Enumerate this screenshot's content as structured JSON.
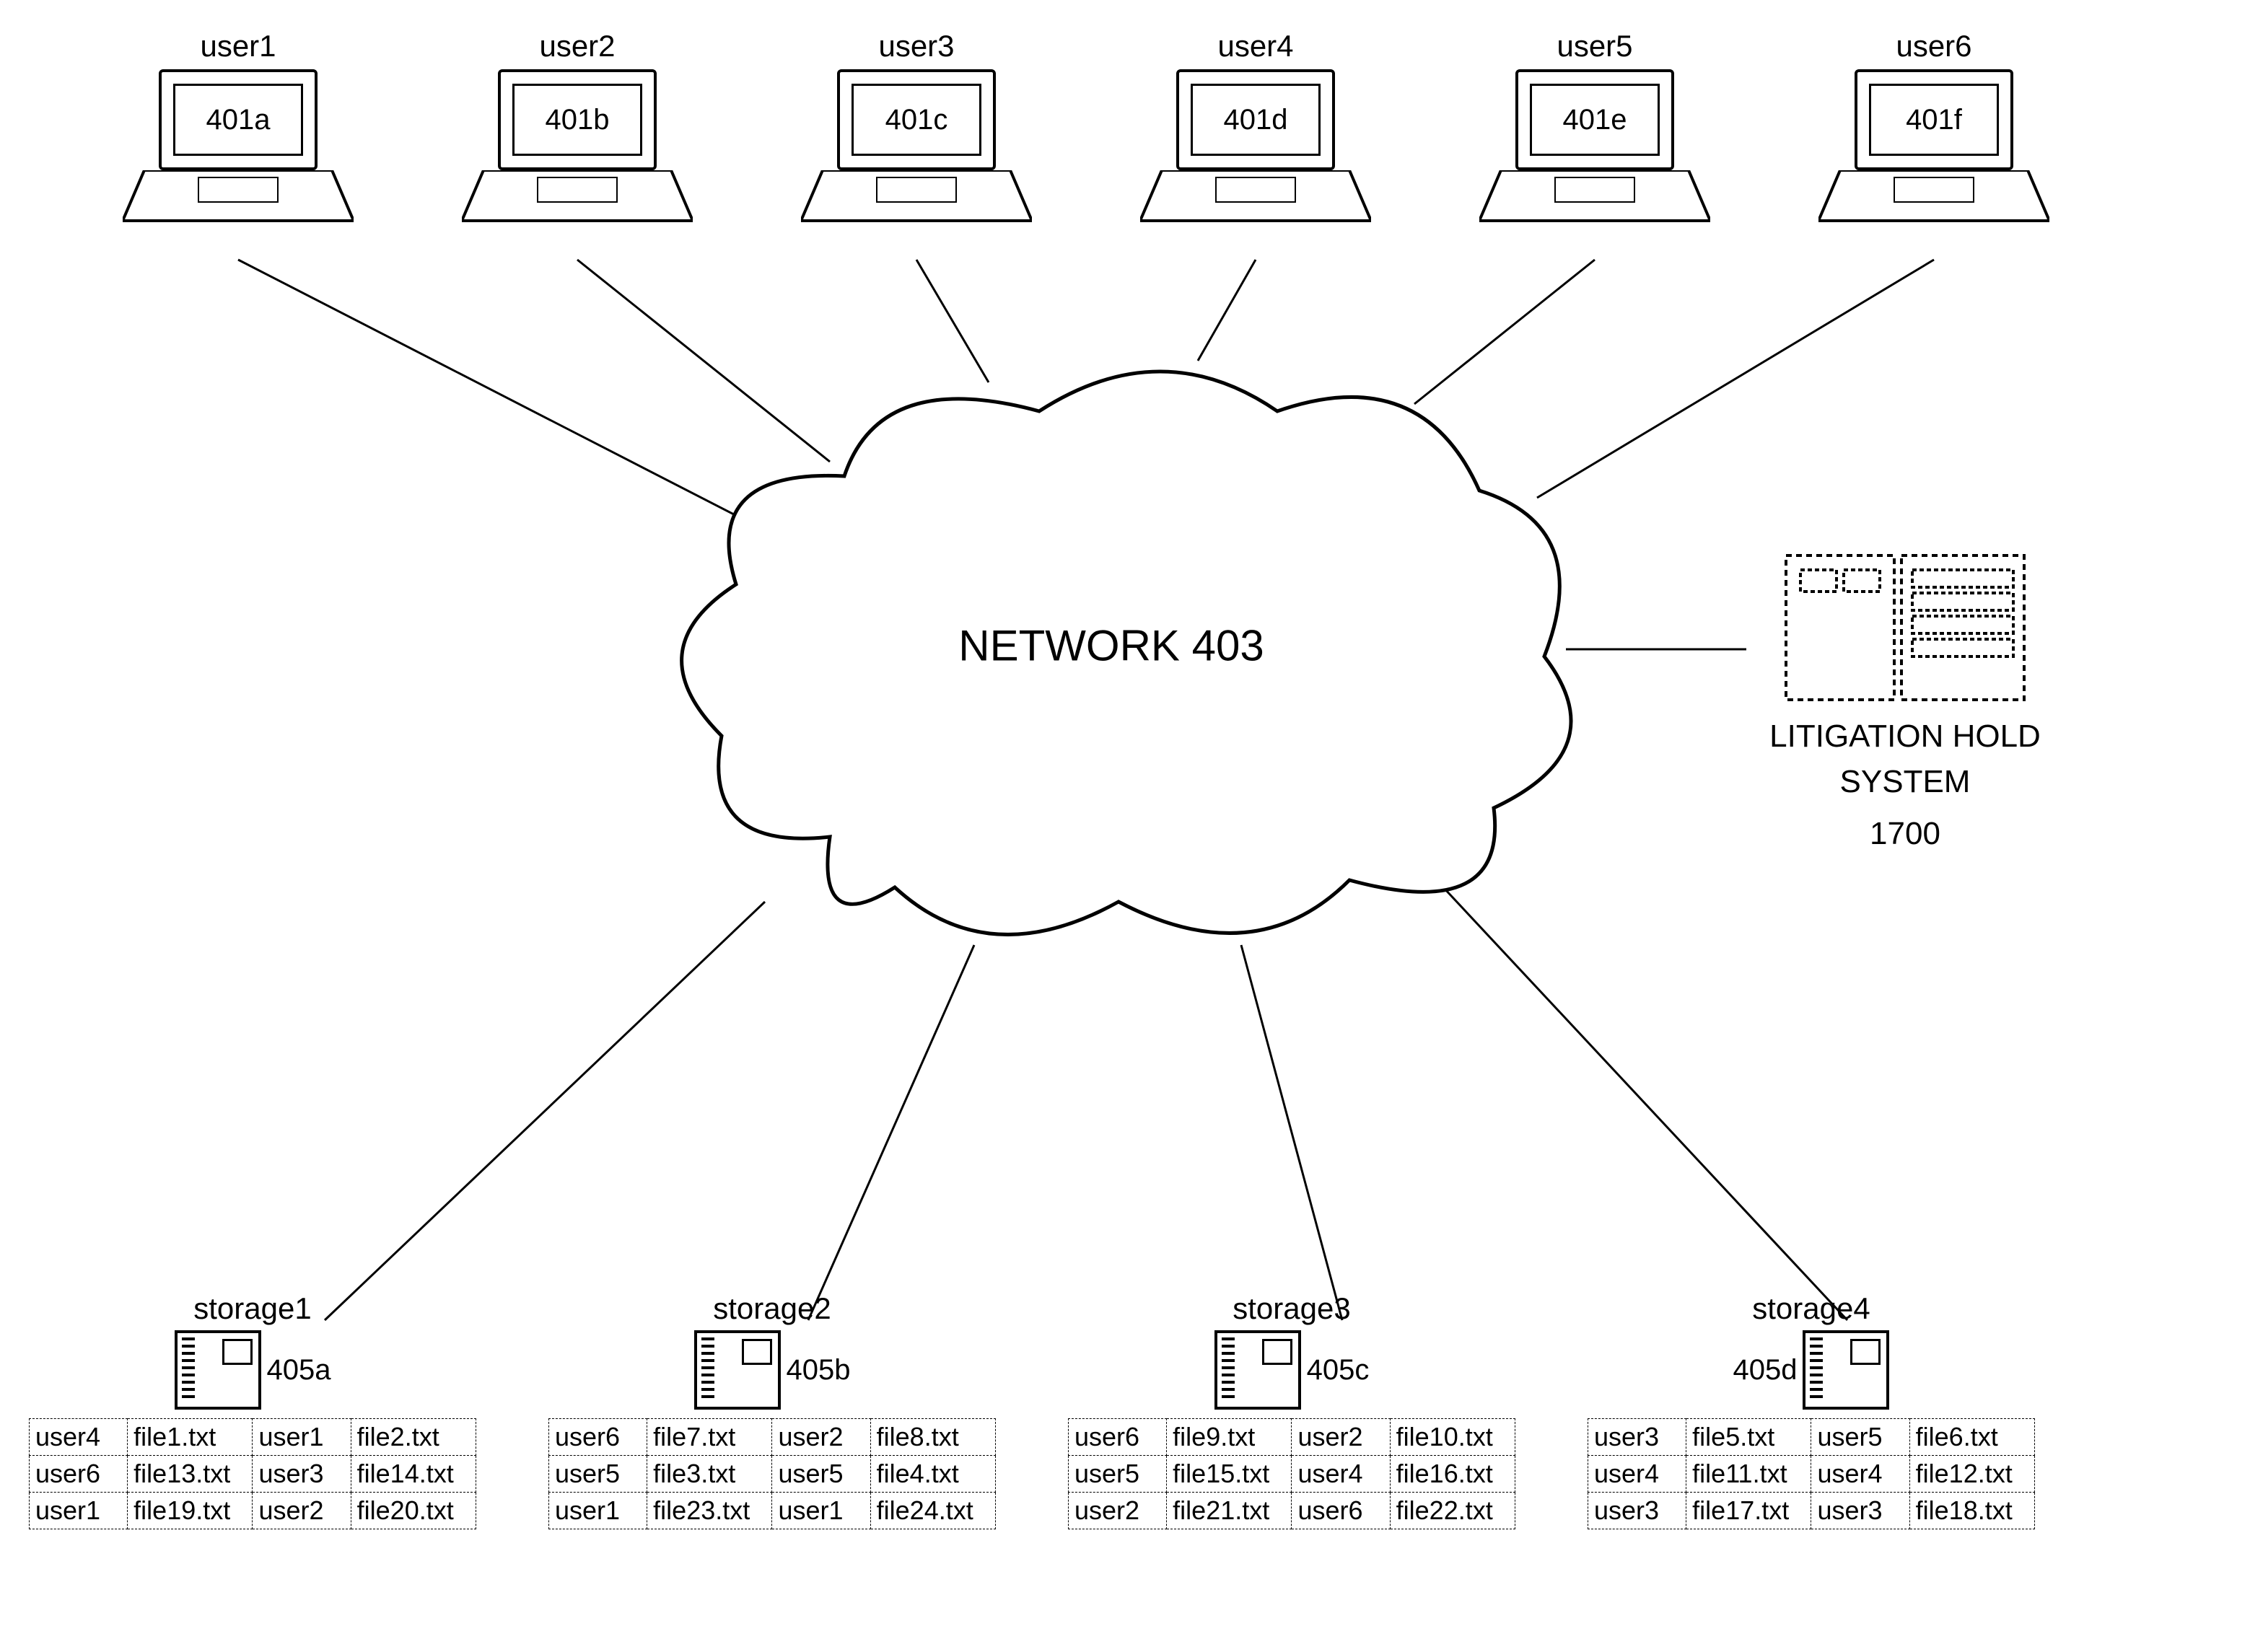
{
  "users": [
    {
      "label": "user1",
      "ref": "401a"
    },
    {
      "label": "user2",
      "ref": "401b"
    },
    {
      "label": "user3",
      "ref": "401c"
    },
    {
      "label": "user4",
      "ref": "401d"
    },
    {
      "label": "user5",
      "ref": "401e"
    },
    {
      "label": "user6",
      "ref": "401f"
    }
  ],
  "cloud": {
    "label": "NETWORK 403"
  },
  "server": {
    "label_line1": "LITIGATION HOLD",
    "label_line2": "SYSTEM",
    "ref": "1700"
  },
  "storages": [
    {
      "label": "storage1",
      "ref": "405a",
      "rows": [
        [
          "user4",
          "file1.txt",
          "user1",
          "file2.txt"
        ],
        [
          "user6",
          "file13.txt",
          "user3",
          "file14.txt"
        ],
        [
          "user1",
          "file19.txt",
          "user2",
          "file20.txt"
        ]
      ]
    },
    {
      "label": "storage2",
      "ref": "405b",
      "rows": [
        [
          "user6",
          "file7.txt",
          "user2",
          "file8.txt"
        ],
        [
          "user5",
          "file3.txt",
          "user5",
          "file4.txt"
        ],
        [
          "user1",
          "file23.txt",
          "user1",
          "file24.txt"
        ]
      ]
    },
    {
      "label": "storage3",
      "ref": "405c",
      "rows": [
        [
          "user6",
          "file9.txt",
          "user2",
          "file10.txt"
        ],
        [
          "user5",
          "file15.txt",
          "user4",
          "file16.txt"
        ],
        [
          "user2",
          "file21.txt",
          "user6",
          "file22.txt"
        ]
      ]
    },
    {
      "label": "storage4",
      "ref": "405d",
      "rows": [
        [
          "user3",
          "file5.txt",
          "user5",
          "file6.txt"
        ],
        [
          "user4",
          "file11.txt",
          "user4",
          "file12.txt"
        ],
        [
          "user3",
          "file17.txt",
          "user3",
          "file18.txt"
        ]
      ]
    }
  ]
}
